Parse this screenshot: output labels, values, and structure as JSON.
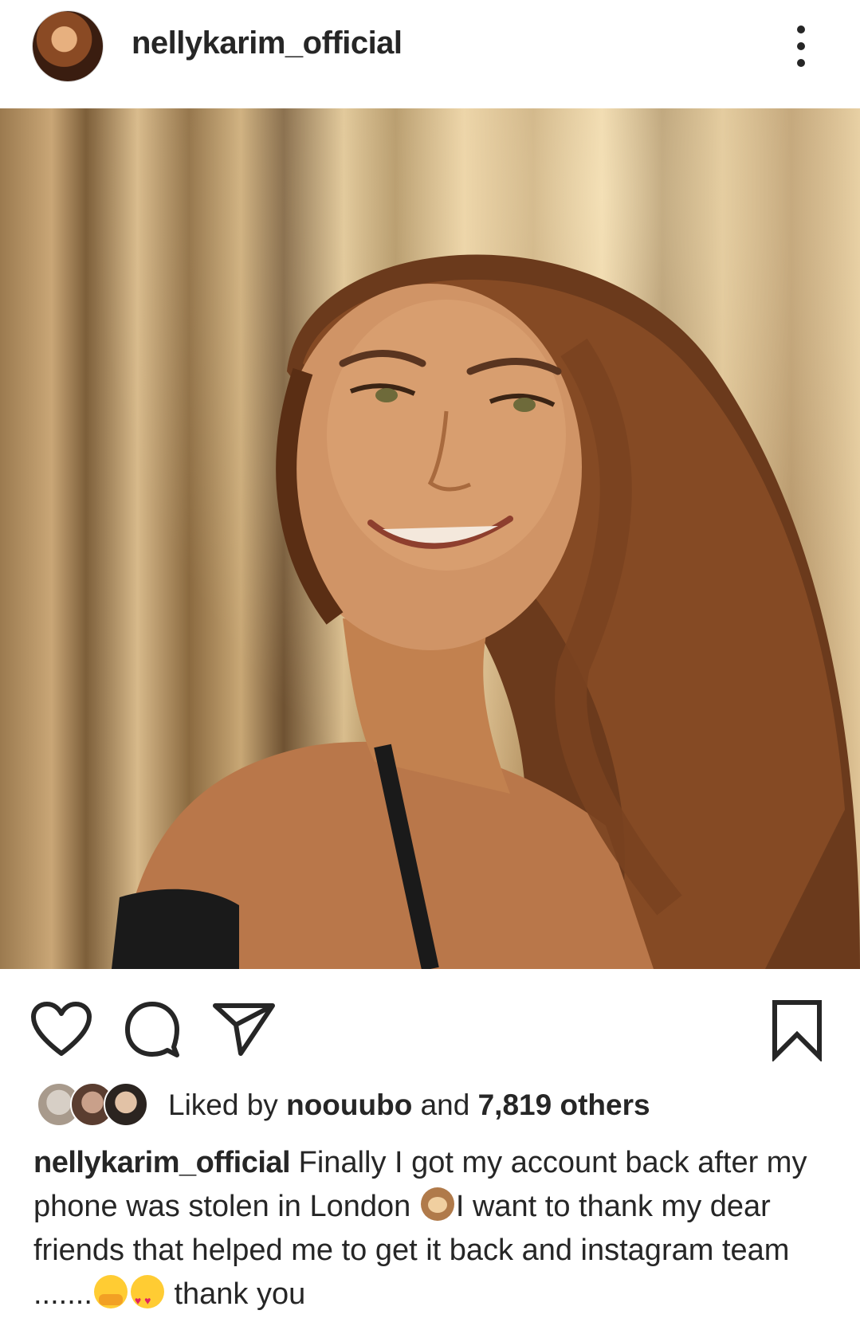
{
  "header": {
    "username": "nellykarim_official",
    "avatar_icon": "profile-avatar",
    "more_icon": "more-vertical-icon"
  },
  "post": {
    "image_icon": "post-photo"
  },
  "actions": {
    "like_icon": "heart-outline-icon",
    "comment_icon": "comment-bubble-icon",
    "share_icon": "paper-plane-icon",
    "save_icon": "bookmark-outline-icon"
  },
  "likes": {
    "prefix": "Liked by ",
    "first_user": "noouubo",
    "middle": " and ",
    "others": "7,819 others"
  },
  "caption": {
    "username": "nellykarim_official",
    "text_1": " Finally I got my account back after my phone was stolen in London ",
    "text_2": "I want to thank my dear friends that helped me to get it back and instagram team .......",
    "text_3": " thank you"
  },
  "colors": {
    "text": "#262626",
    "background": "#ffffff"
  }
}
